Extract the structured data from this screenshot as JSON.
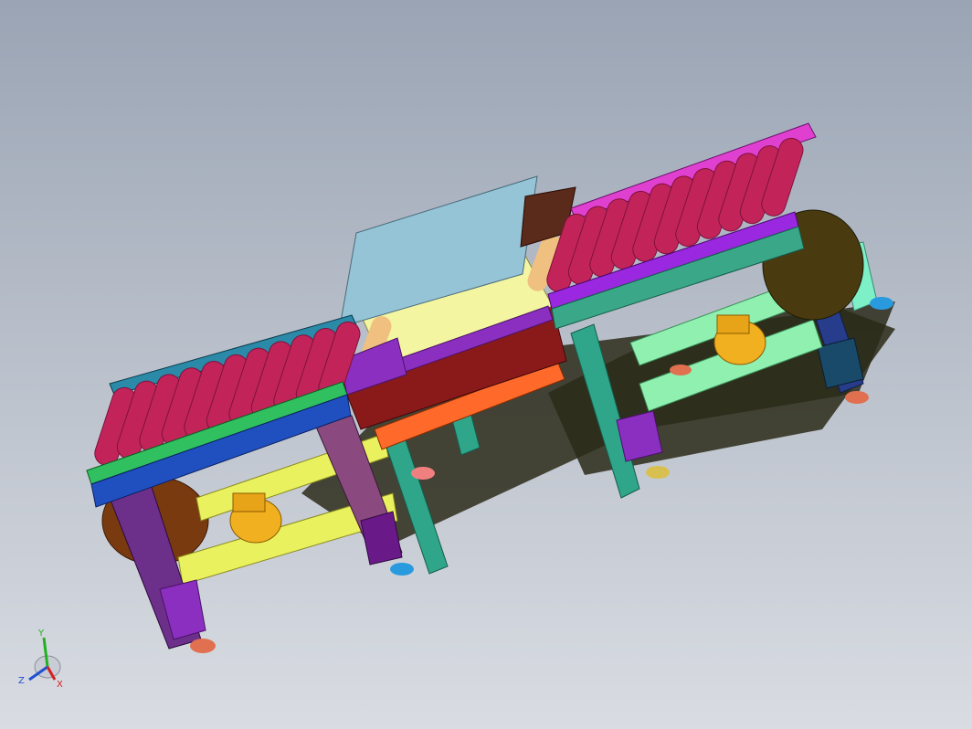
{
  "viewport": {
    "background_top": "#9aa4b4",
    "background_bottom": "#d9dce2"
  },
  "model": {
    "roller_color": "#c2245a",
    "roller_shadow": "#7e123b",
    "frame_teal": "#2fa58a",
    "frame_purple": "#8a2fbf",
    "motor_color": "#f0b020",
    "plate_color": "#94c4d6",
    "leg_color": "#6c2f8a",
    "brace_yellow": "#e9f25e",
    "brace_green": "#8ff0b0",
    "pulley_color": "#7a3a10"
  },
  "triad": {
    "x_label": "X",
    "y_label": "Y",
    "z_label": "Z",
    "x_color": "#d42020",
    "y_color": "#20b020",
    "z_color": "#2050d0"
  }
}
